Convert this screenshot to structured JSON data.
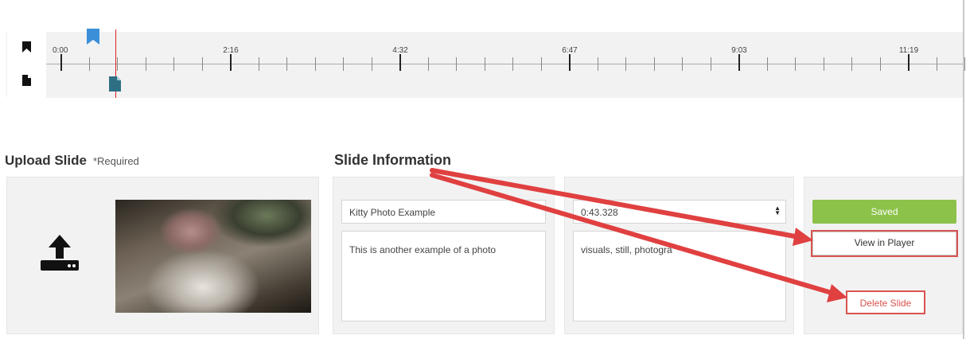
{
  "timeline": {
    "tick_labels": [
      "0:00",
      "2:16",
      "4:32",
      "6:47",
      "9:03",
      "11:19"
    ],
    "bookmark_row_icon": "bookmark-icon",
    "slide_row_icon": "slide-file-icon",
    "accent_color": "#3b8fd8",
    "slide_marker_color": "#2f6f86",
    "playhead_color": "#e02020"
  },
  "upload": {
    "heading": "Upload Slide",
    "required_note": "*Required",
    "upload_icon": "upload-icon"
  },
  "slide_info": {
    "heading": "Slide Information",
    "title_value": "Kitty Photo Example",
    "description_value": "This is another example of a photo",
    "time_value": "0:43.328",
    "tags_value": "visuals, still, photogra"
  },
  "actions": {
    "saved_label": "Saved",
    "view_label": "View in Player",
    "delete_label": "Delete Slide",
    "saved_color": "#8cc24a",
    "highlight_color": "#d9534f"
  }
}
